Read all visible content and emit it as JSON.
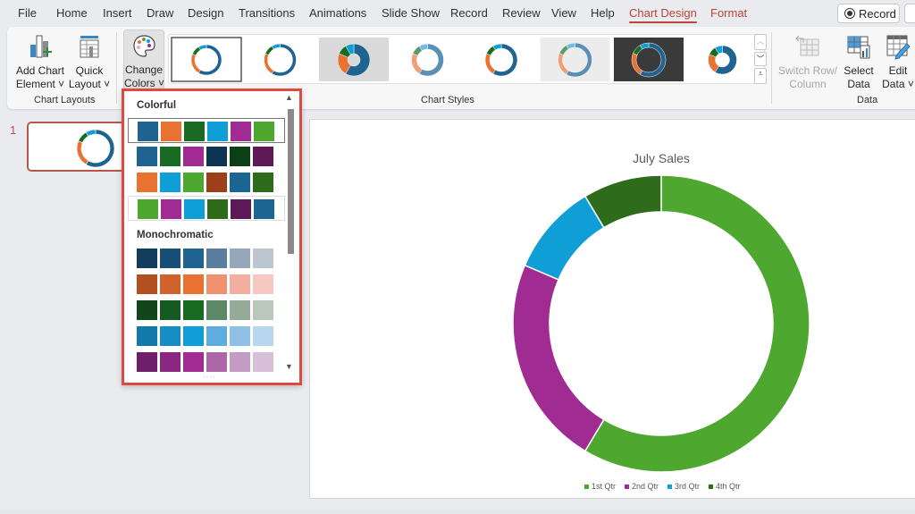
{
  "menu": {
    "tabs": [
      {
        "label": "File"
      },
      {
        "label": "Home"
      },
      {
        "label": "Insert"
      },
      {
        "label": "Draw"
      },
      {
        "label": "Design"
      },
      {
        "label": "Transitions"
      },
      {
        "label": "Animations"
      },
      {
        "label": "Slide Show"
      },
      {
        "label": "Record"
      },
      {
        "label": "Review"
      },
      {
        "label": "View"
      },
      {
        "label": "Help"
      },
      {
        "label": "Chart Design"
      },
      {
        "label": "Format"
      }
    ],
    "active_tab": "Chart Design",
    "record_button": "Record"
  },
  "ribbon": {
    "chart_layouts": {
      "add_chart_element": [
        "Add Chart",
        "Element"
      ],
      "quick_layout": [
        "Quick",
        "Layout"
      ],
      "group_label": "Chart Layouts"
    },
    "change_colors": [
      "Change",
      "Colors"
    ],
    "chart_styles": {
      "group_label": "Chart Styles",
      "style_count": 8,
      "selected_index": 0
    },
    "data": {
      "switch_row_column": [
        "Switch Row/",
        "Column"
      ],
      "select_data": [
        "Select",
        "Data"
      ],
      "edit_data": [
        "Edit",
        "Data"
      ],
      "group_label": "Data"
    }
  },
  "slides_panel": {
    "slide_number": "1"
  },
  "color_dropdown": {
    "colorful_heading": "Colorful",
    "colorful_rows": [
      [
        "#1f6391",
        "#e97132",
        "#196b24",
        "#0f9ed5",
        "#a02b93",
        "#4ea72e"
      ],
      [
        "#1f6391",
        "#196b24",
        "#a02b93",
        "#0e3453",
        "#0d3f14",
        "#5e1a58"
      ],
      [
        "#e97132",
        "#0f9ed5",
        "#4ea72e",
        "#9b4019",
        "#1a6592",
        "#2e6b1b"
      ],
      [
        "#4ea72e",
        "#a02b93",
        "#0f9ed5",
        "#2e6b1b",
        "#5e1a58",
        "#1a6592"
      ]
    ],
    "selected_row": 0,
    "monochromatic_heading": "Monochromatic",
    "monochromatic_rows": [
      [
        "#133d5c",
        "#174f78",
        "#1f6391",
        "#5b7d9e",
        "#95a7bb",
        "#bcc6d1"
      ],
      [
        "#b0511e",
        "#d1622b",
        "#e97132",
        "#ef9270",
        "#f2afa0",
        "#f5c9c2"
      ],
      [
        "#12461a",
        "#165a22",
        "#196b24",
        "#5e8967",
        "#95ab98",
        "#bac8bc"
      ],
      [
        "#1379aa",
        "#178dc6",
        "#0f9ed5",
        "#5eace0",
        "#91c0e6",
        "#b9d6ef"
      ],
      [
        "#6f1f6a",
        "#8a2780",
        "#a02b93",
        "#ad67a8",
        "#c39bc3",
        "#d8bfd8"
      ]
    ]
  },
  "chart_data": {
    "type": "pie",
    "subtype": "doughnut",
    "title": "July Sales",
    "categories": [
      "1st Qtr",
      "2nd Qtr",
      "3rd Qtr",
      "4th Qtr"
    ],
    "values": [
      8.2,
      3.2,
      1.4,
      1.2
    ],
    "colors": [
      "#4ea72e",
      "#a02b93",
      "#0f9ed5",
      "#2e6b1b"
    ],
    "legend": "bottom"
  },
  "thumbnail_chart": {
    "colors": [
      "#1f6391",
      "#e97132",
      "#196b24",
      "#0f9ed5"
    ]
  }
}
